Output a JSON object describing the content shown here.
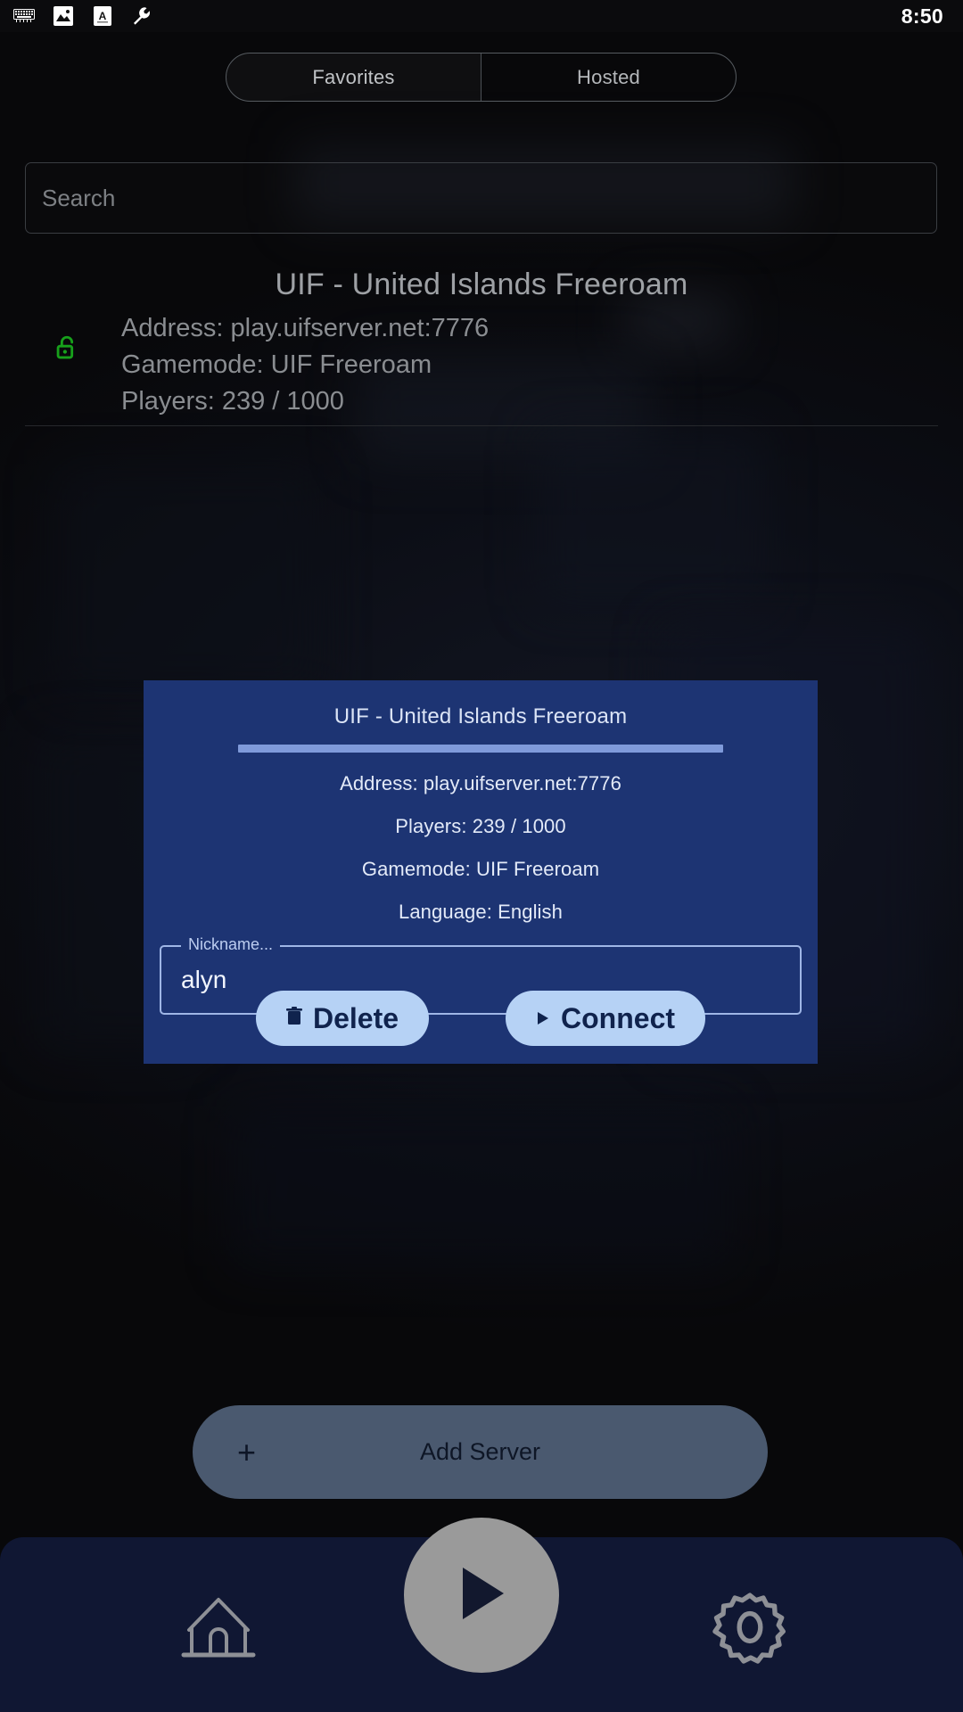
{
  "status_bar": {
    "time": "8:50",
    "icons": [
      "keyboard-icon",
      "image-icon",
      "text-a-icon",
      "wrench-icon"
    ]
  },
  "tabs": [
    {
      "label": "Favorites",
      "selected": true
    },
    {
      "label": "Hosted",
      "selected": false
    }
  ],
  "search": {
    "placeholder": "Search",
    "value": ""
  },
  "server_list": [
    {
      "lock": "lock-open-icon",
      "lock_color": "#17a01b",
      "title": "UIF - United Islands Freeroam",
      "address": "Address: play.uifserver.net:7776",
      "gamemode": "Gamemode: UIF Freeroam",
      "players": "Players: 239 / 1000"
    }
  ],
  "add_server": {
    "label": "Add Server",
    "icon": "plus-icon"
  },
  "bottom_nav": {
    "home": "home-icon",
    "play": "play-icon",
    "settings": "gear-icon"
  },
  "modal": {
    "title": "UIF - United Islands Freeroam",
    "address": "Address: play.uifserver.net:7776",
    "players": "Players: 239 / 1000",
    "gamemode": "Gamemode: UIF Freeroam",
    "language": "Language: English",
    "nickname_label": "Nickname...",
    "nickname_value": "alyn",
    "delete_button": "Delete",
    "connect_button": "Connect",
    "delete_icon": "trash-icon",
    "connect_icon": "play-triangle-icon"
  },
  "colors": {
    "modal_bg": "#1d3473",
    "modal_button": "#b6d2f5",
    "modal_divider": "#7f9ada",
    "accent_green": "#17a01b",
    "add_server_bg": "#4a596f",
    "bottom_nav_bg": "#101733"
  }
}
